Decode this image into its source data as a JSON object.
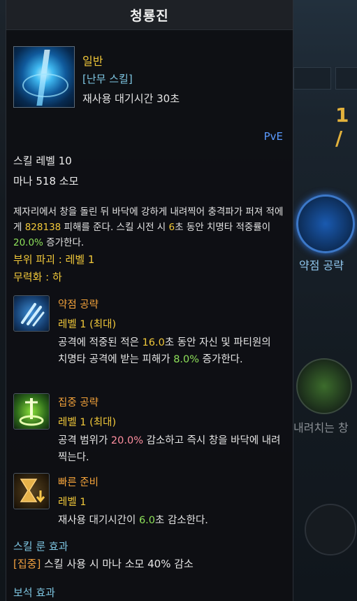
{
  "tooltip": {
    "title": "청룡진",
    "grade": "일반",
    "skill_type": "[난무 스킬]",
    "cooldown": "재사용 대기시간 30초",
    "pve_label": "PvE",
    "skill_level": "스킬 레벨 10",
    "mana": "마나 518 소모",
    "desc_parts": {
      "p1": "제자리에서 창을 돌린 뒤 바닥에 강하게 내려찍어 충격파가 퍼져 적에게 ",
      "dmg": "828138",
      "p2": " 피해를 준다. 스킬 시전 시 ",
      "sec": "6",
      "p3": "초 동안 치명타 적중률이 ",
      "pct": "20.0%",
      "p4": " 증가한다."
    },
    "part_break": "부위 파괴 : 레벨 1",
    "stagger": "무력화 : 하",
    "tripods": [
      {
        "name": "약점 공략",
        "level": "레벨 1 (최대)",
        "d1": "공격에 적중된 적은 ",
        "v1": "16.0",
        "d2": "초 동안 자신 및 파티원의 치명타 공격에 받는 피해가 ",
        "v2": "8.0%",
        "d3": " 증가한다.",
        "icon": "claw-icon"
      },
      {
        "name": "집중 공략",
        "level": "레벨 1 (최대)",
        "d1": "공격 범위가 ",
        "v1": "20.0%",
        "d2": " 감소하고 즉시 창을 바닥에 내려찍는다.",
        "icon": "spear-strike-icon"
      },
      {
        "name": "빠른 준비",
        "level": "레벨 1",
        "d1": "재사용 대기시간이 ",
        "v1": "6.0",
        "d2": "초 감소한다.",
        "icon": "hourglass-icon"
      }
    ],
    "rune_title": "스킬 룬 효과",
    "rune_name": "[집중]",
    "rune_desc": " 스킬 사용 시 마나 소모 40% 감소",
    "gem_title": "보석 효과"
  },
  "background": {
    "side_num": "1 /",
    "side_label_1": "약점 공략",
    "side_label_2": "내려치는 창",
    "bg_slot_a": "4",
    "bg_slot_b": "5"
  },
  "colors": {
    "gold": "#f1c83a",
    "orange": "#f1a13a",
    "green": "#8ee15a",
    "pink": "#ff8fa0",
    "skyblue": "#7fc7e3",
    "pve_blue": "#5b9bff"
  }
}
